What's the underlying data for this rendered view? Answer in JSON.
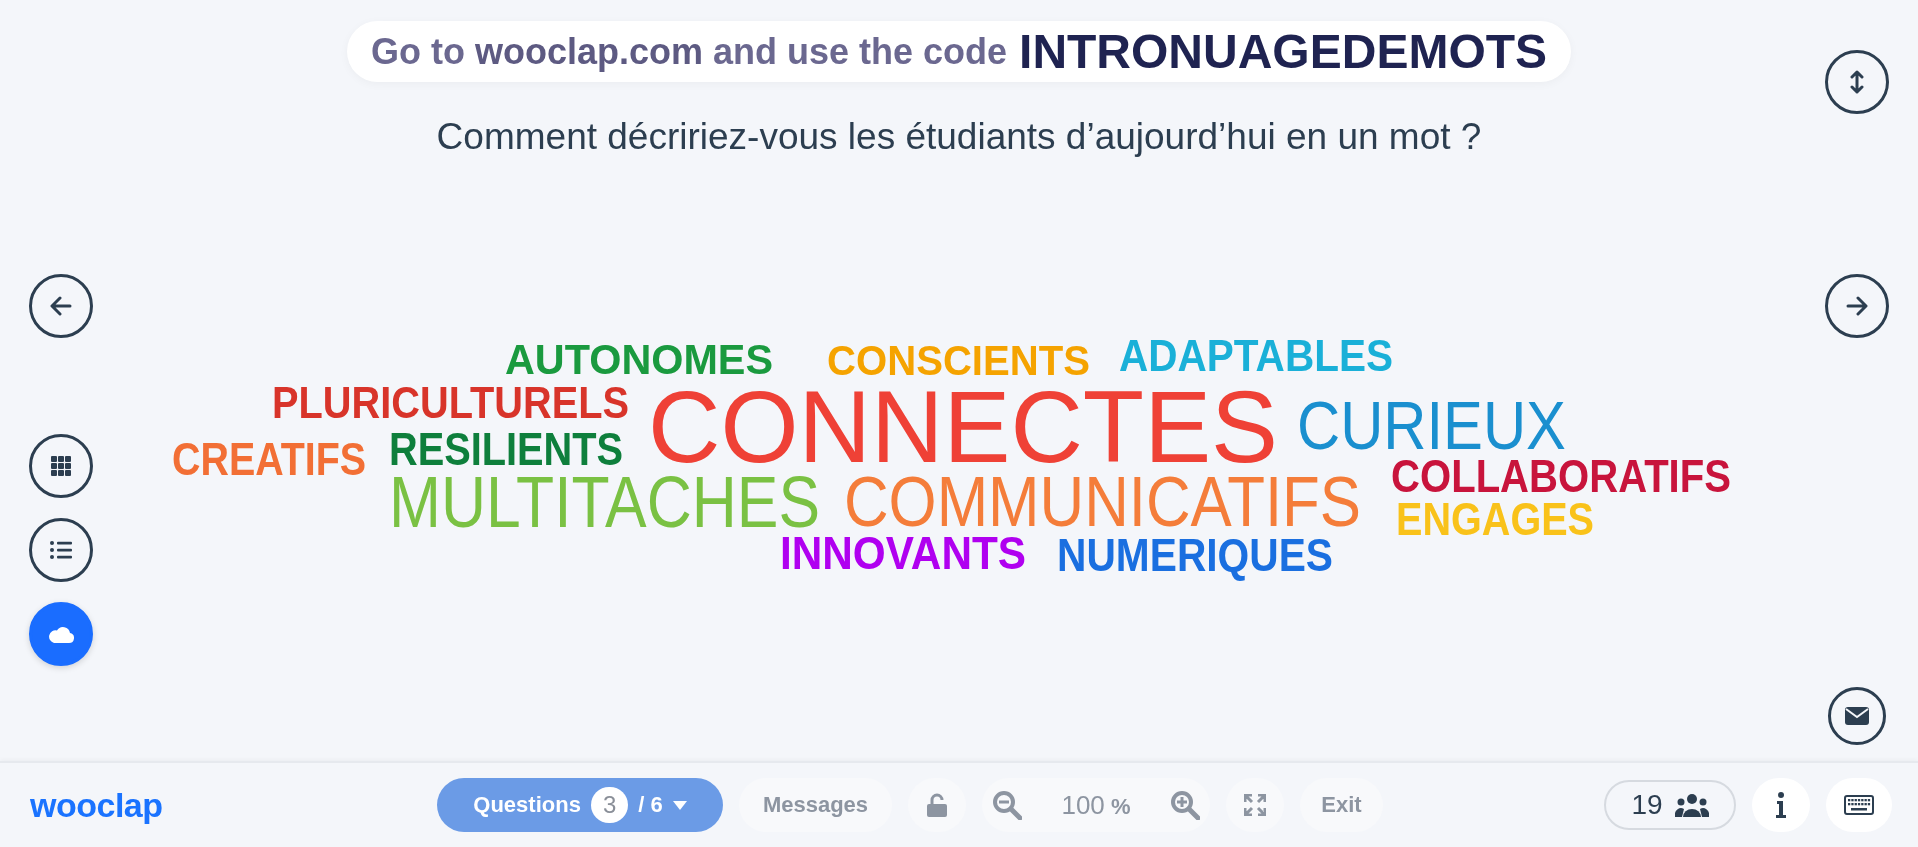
{
  "banner": {
    "text": "Go to **wooclap.com** and use the code",
    "code": "INTRONUAGEDEMOTS"
  },
  "question": "Comment décririez-vous les étudiants d’aujourd’hui en un mot ?",
  "view_buttons": [
    {
      "kind": "grid",
      "selected": false
    },
    {
      "kind": "list",
      "selected": false
    },
    {
      "kind": "cloud",
      "selected": true
    }
  ],
  "word_cloud": [
    {
      "text": "AUTONOMES",
      "color": "#1a9a3f"
    },
    {
      "text": "CONSCIENTS",
      "color": "#f5a300"
    },
    {
      "text": "ADAPTABLES",
      "color": "#1ab0d8"
    },
    {
      "text": "PLURICULTURELS",
      "color": "#d8342a"
    },
    {
      "text": "CONNECTES",
      "color": "#ef4136"
    },
    {
      "text": "CURIEUX",
      "color": "#1a8fcf"
    },
    {
      "text": "CREATIFS",
      "color": "#f26f35"
    },
    {
      "text": "RESILIENTS",
      "color": "#0e7f3c"
    },
    {
      "text": "COLLABORATIFS",
      "color": "#c8143c"
    },
    {
      "text": "MULTITACHES",
      "color": "#7ac143"
    },
    {
      "text": "COMMUNICATIFS",
      "color": "#f47d3a"
    },
    {
      "text": "ENGAGES",
      "color": "#f9c21a"
    },
    {
      "text": "INNOVANTS",
      "color": "#b000f0"
    },
    {
      "text": "NUMERIQUES",
      "color": "#1a6fe0"
    }
  ],
  "footer": {
    "logo": "wooclap",
    "questions": {
      "label": "Questions",
      "current": "3",
      "total": "/ 6",
      "disabled": true
    },
    "messages": {
      "label": "Messages",
      "disabled": true
    },
    "lock": {
      "disabled": true
    },
    "zoom": {
      "value": "100",
      "unit": "%",
      "disabled": true
    },
    "fullscreen": {
      "disabled": true
    },
    "exit": {
      "label": "Exit",
      "disabled": true
    },
    "participants": "19"
  }
}
